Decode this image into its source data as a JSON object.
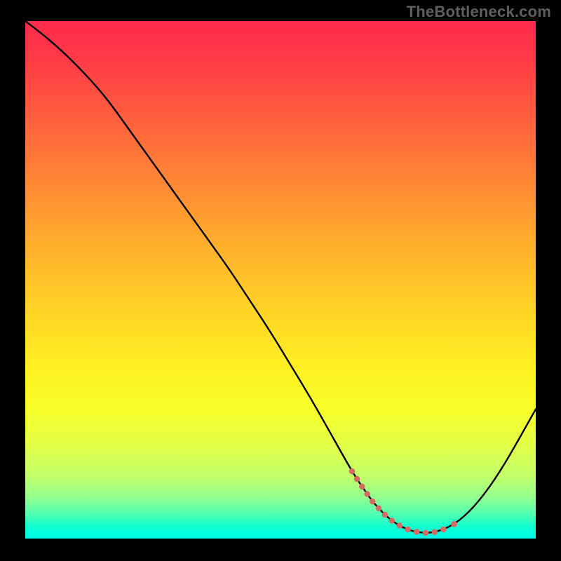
{
  "watermark": "TheBottleneck.com",
  "colors": {
    "page_bg": "#000000",
    "watermark": "#5f5f5f",
    "curve": "#000000",
    "dots": "#d86a66",
    "gradient_stops": [
      "#ff2b4a",
      "#ff3249",
      "#ff4943",
      "#ff6a3b",
      "#ff8a34",
      "#ffab2d",
      "#ffd126",
      "#fff022",
      "#f7ff29",
      "#e2ff47",
      "#c0ff6a",
      "#93ff8e",
      "#58ffad",
      "#14ffce",
      "#00ffe0",
      "#00f7e8"
    ]
  },
  "chart_data": {
    "type": "line",
    "title": "",
    "xlabel": "",
    "ylabel": "",
    "xlim": [
      0,
      100
    ],
    "ylim": [
      0,
      100
    ],
    "grid": false,
    "legend": false,
    "series": [
      {
        "name": "bottleneck-curve",
        "x": [
          0,
          4,
          8,
          12,
          16,
          20,
          24,
          28,
          32,
          36,
          40,
          44,
          48,
          52,
          56,
          60,
          62,
          64,
          66,
          68,
          70,
          72,
          74,
          76,
          78,
          80,
          82,
          84,
          86,
          88,
          90,
          92,
          94,
          96,
          98,
          100
        ],
        "y": [
          100,
          97,
          93.5,
          89.5,
          85,
          79.5,
          74,
          68.5,
          63,
          57.5,
          52,
          46,
          40,
          33.5,
          27,
          20,
          16.5,
          13,
          10,
          7.2,
          5,
          3.3,
          2.1,
          1.4,
          1.1,
          1.2,
          1.8,
          2.8,
          4.3,
          6.3,
          8.7,
          11.5,
          14.6,
          18,
          21.5,
          25
        ]
      }
    ],
    "highlight_range_x": [
      63,
      82
    ],
    "highlight_range_note": "near-zero plateau marked with coral dots",
    "highlight_separate_point_x": 84
  }
}
